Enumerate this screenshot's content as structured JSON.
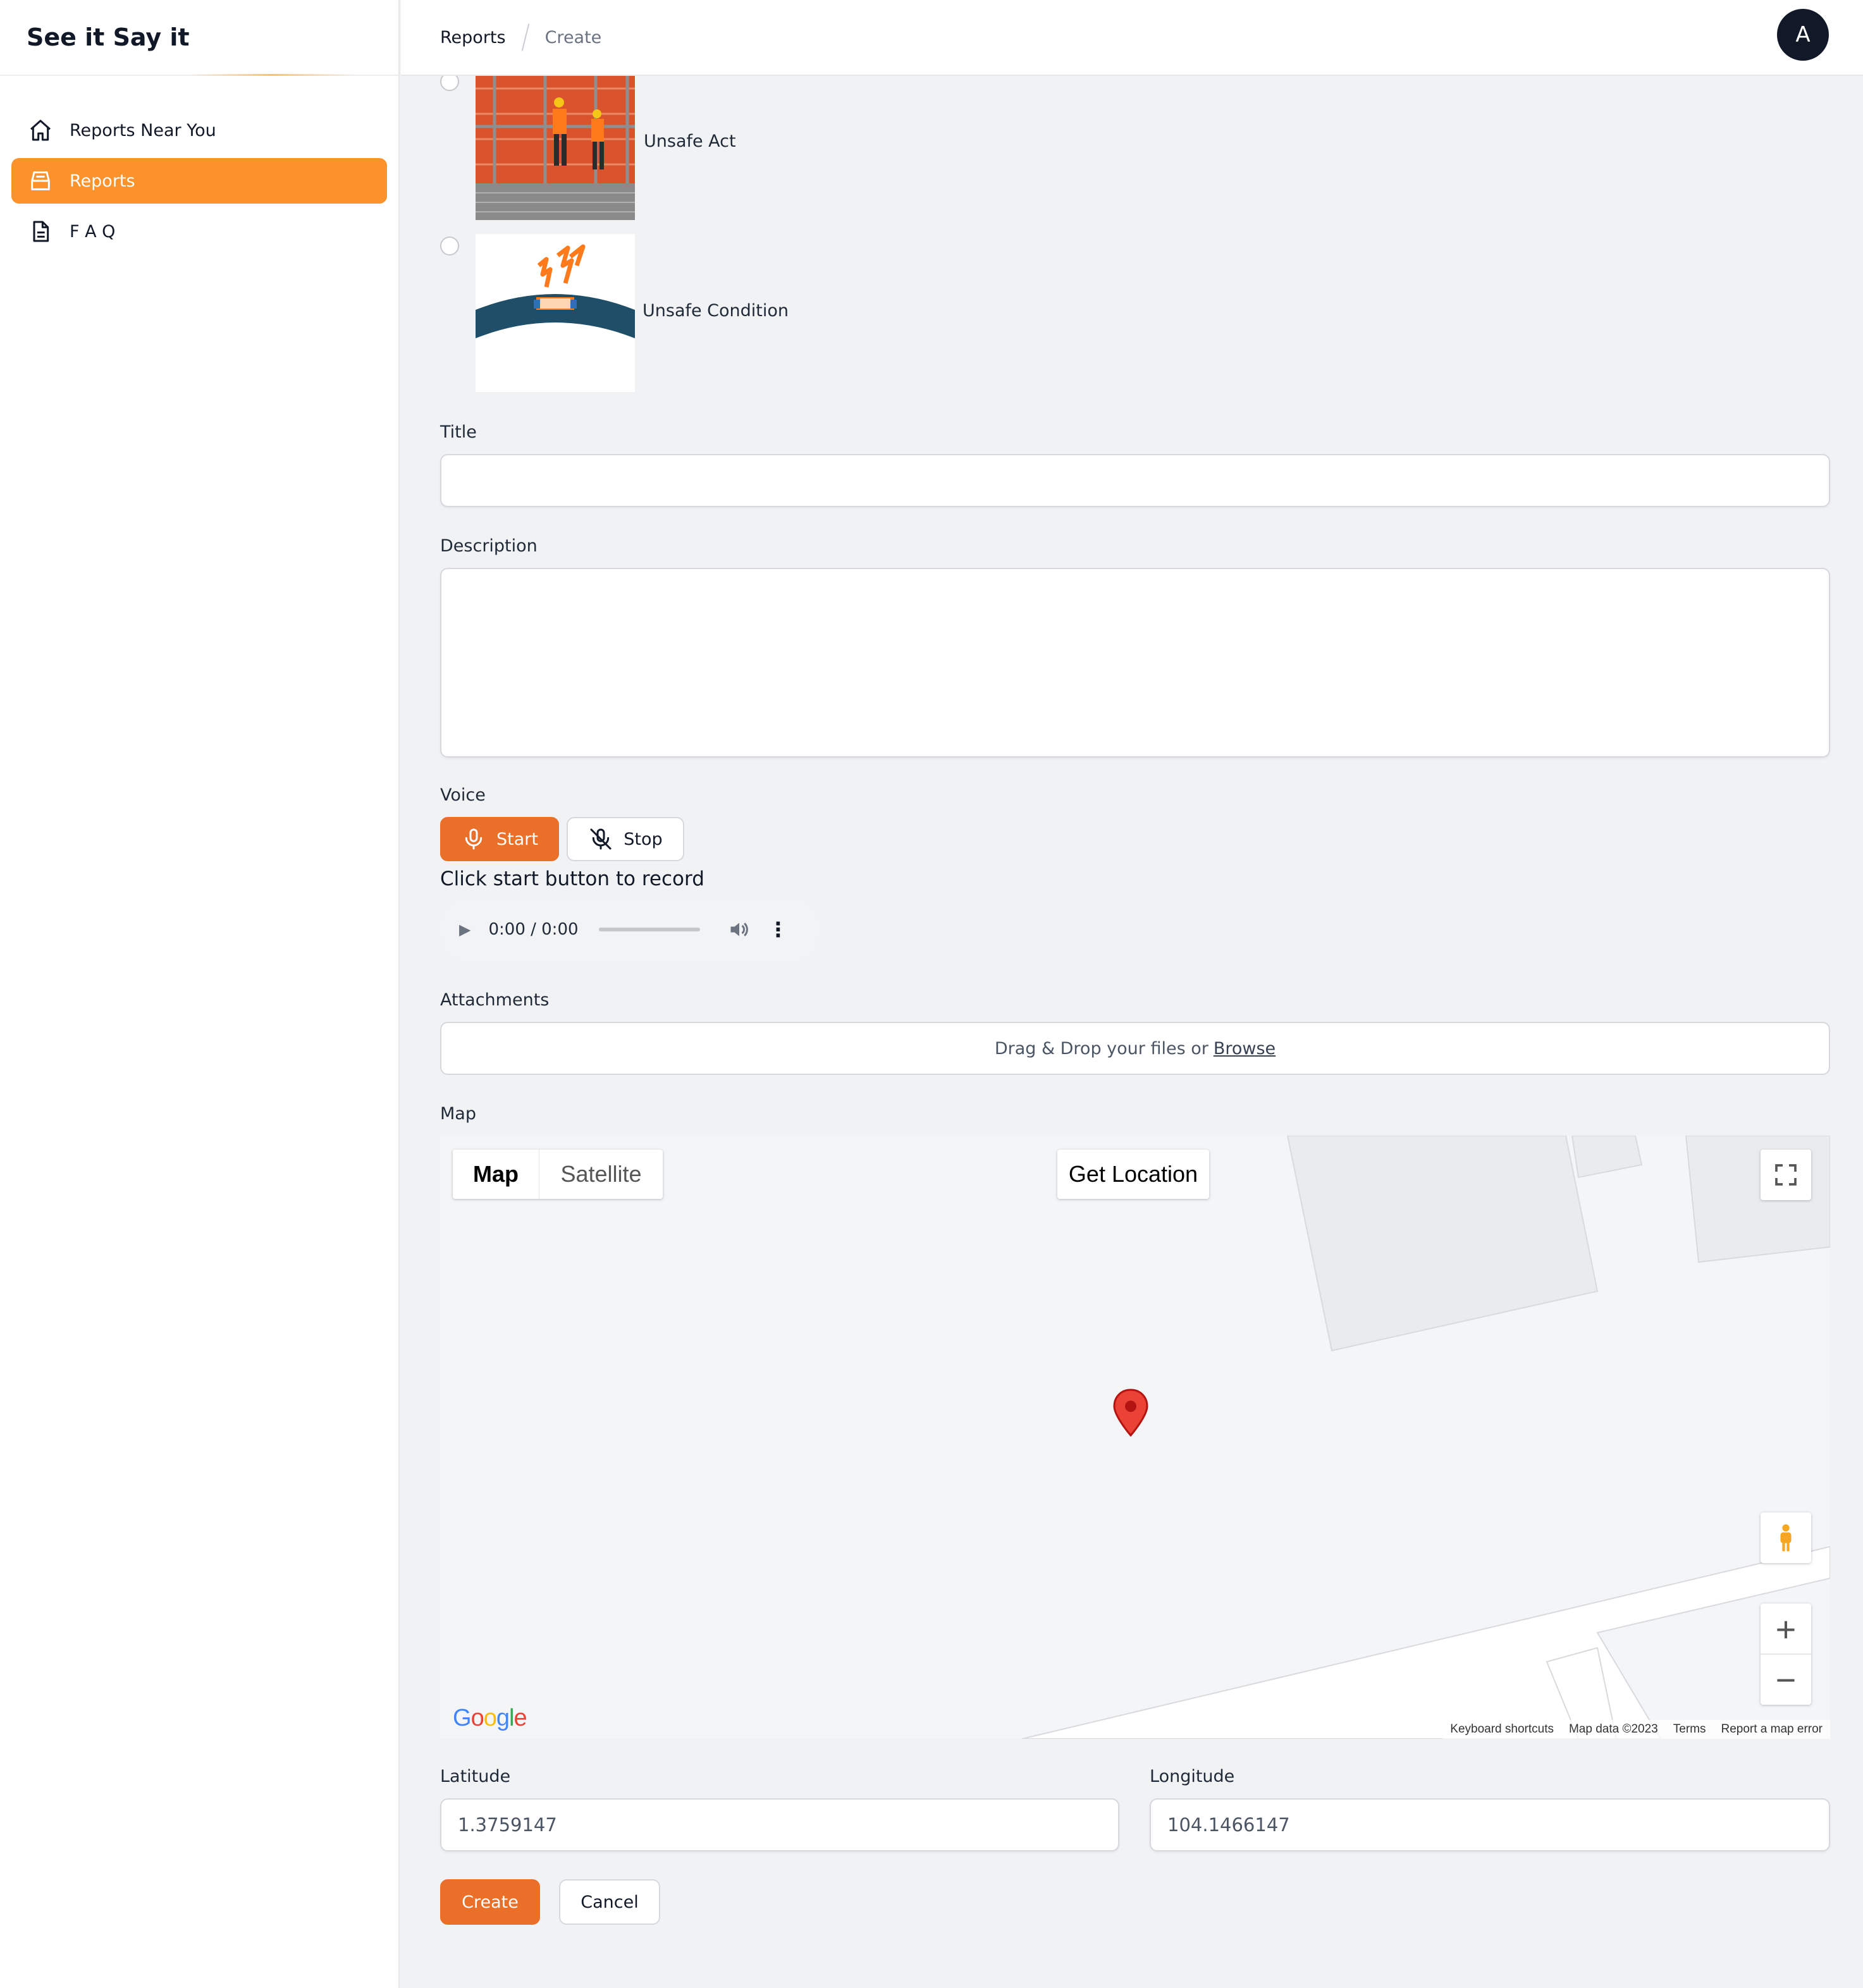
{
  "app": {
    "title": "See it Say it"
  },
  "sidebar": {
    "items": [
      {
        "label": "Reports Near You",
        "icon": "home-icon"
      },
      {
        "label": "Reports",
        "icon": "tray-icon",
        "active": true
      },
      {
        "label": "F A Q",
        "icon": "document-icon"
      }
    ]
  },
  "header": {
    "breadcrumb": [
      "Reports",
      "Create"
    ],
    "avatar_initial": "A"
  },
  "form": {
    "types": [
      {
        "label": "Unsafe Act",
        "selected": false
      },
      {
        "label": "Unsafe Condition",
        "selected": false
      }
    ],
    "title_label": "Title",
    "title_value": "",
    "description_label": "Description",
    "description_value": "",
    "voice_label": "Voice",
    "start_label": "Start",
    "stop_label": "Stop",
    "record_hint": "Click start button to record",
    "audio_time": "0:00 / 0:00",
    "attachments_label": "Attachments",
    "drop_text": "Drag & Drop your files or",
    "browse_label": "Browse",
    "map_label": "Map",
    "latitude_label": "Latitude",
    "latitude_value": "1.3759147",
    "longitude_label": "Longitude",
    "longitude_value": "104.1466147",
    "create_label": "Create",
    "cancel_label": "Cancel"
  },
  "map": {
    "type_map": "Map",
    "type_satellite": "Satellite",
    "get_location": "Get Location",
    "logo": "Google",
    "footer": [
      "Keyboard shortcuts",
      "Map data ©2023",
      "Terms",
      "Report a map error"
    ]
  },
  "colors": {
    "accent": "#fb922c",
    "button": "#ea7029",
    "avatar": "#111827"
  }
}
